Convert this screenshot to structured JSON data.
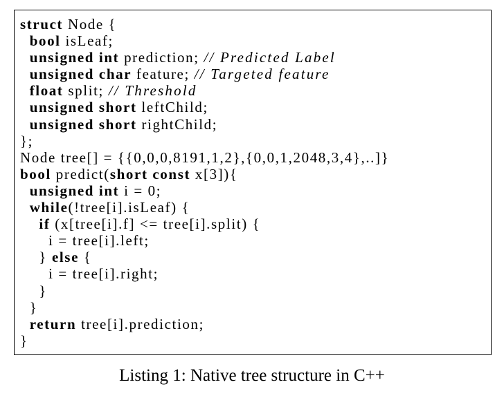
{
  "listing": {
    "lines": [
      [
        {
          "k": "kw",
          "t": "struct"
        },
        {
          "t": " Node {"
        }
      ],
      [
        {
          "t": "  "
        },
        {
          "k": "kw",
          "t": "bool"
        },
        {
          "t": " isLeaf;"
        }
      ],
      [
        {
          "t": "  "
        },
        {
          "k": "kw",
          "t": "unsigned int"
        },
        {
          "t": " prediction; "
        },
        {
          "k": "cm",
          "t": "// Predicted Label"
        }
      ],
      [
        {
          "t": "  "
        },
        {
          "k": "kw",
          "t": "unsigned char"
        },
        {
          "t": " feature; "
        },
        {
          "k": "cm",
          "t": "// Targeted feature"
        }
      ],
      [
        {
          "t": "  "
        },
        {
          "k": "kw",
          "t": "float"
        },
        {
          "t": " split; "
        },
        {
          "k": "cm",
          "t": "// Threshold"
        }
      ],
      [
        {
          "t": "  "
        },
        {
          "k": "kw",
          "t": "unsigned short"
        },
        {
          "t": " leftChild;"
        }
      ],
      [
        {
          "t": "  "
        },
        {
          "k": "kw",
          "t": "unsigned short"
        },
        {
          "t": " rightChild;"
        }
      ],
      [
        {
          "t": "};"
        }
      ],
      [
        {
          "t": "Node tree[] = {{0,0,0,8191,1,2},{0,0,1,2048,3,4},..]}"
        }
      ],
      [
        {
          "k": "kw",
          "t": "bool"
        },
        {
          "t": " predict("
        },
        {
          "k": "kw",
          "t": "short const"
        },
        {
          "t": " x[3]){"
        }
      ],
      [
        {
          "t": "  "
        },
        {
          "k": "kw",
          "t": "unsigned int"
        },
        {
          "t": " i = 0;"
        }
      ],
      [
        {
          "t": "  "
        },
        {
          "k": "kw",
          "t": "while"
        },
        {
          "t": "(!tree[i].isLeaf) {"
        }
      ],
      [
        {
          "t": "    "
        },
        {
          "k": "kw",
          "t": "if"
        },
        {
          "t": " (x[tree[i].f] <= tree[i].split) {"
        }
      ],
      [
        {
          "t": "      i = tree[i].left;"
        }
      ],
      [
        {
          "t": "    } "
        },
        {
          "k": "kw",
          "t": "else"
        },
        {
          "t": " {"
        }
      ],
      [
        {
          "t": "      i = tree[i].right;"
        }
      ],
      [
        {
          "t": "    }"
        }
      ],
      [
        {
          "t": "  }"
        }
      ],
      [
        {
          "t": "  "
        },
        {
          "k": "kw",
          "t": "return"
        },
        {
          "t": " tree[i].prediction;"
        }
      ],
      [
        {
          "t": "}"
        }
      ]
    ]
  },
  "caption": "Listing 1: Native tree structure in C++"
}
